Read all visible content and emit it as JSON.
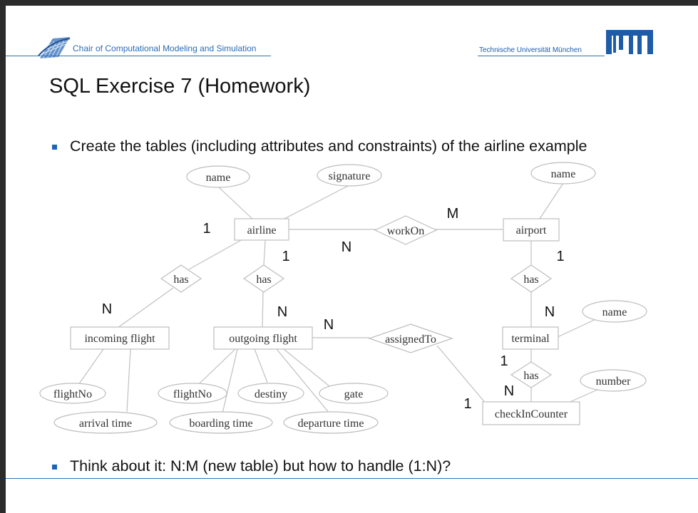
{
  "header": {
    "chair_name": "Chair of Computational Modeling and Simulation",
    "university": "Technische Universität München"
  },
  "slide": {
    "title": "SQL Exercise 7 (Homework)",
    "bullet_1": "Create the tables (including attributes and constraints) of the airline example",
    "bullet_2": "Think about it: N:M (new table) but how to handle (1:N)?"
  },
  "colors": {
    "accent_blue": "#2e74b5",
    "tum_blue": "#1f5ca8",
    "diagram_line": "#c0c0c0",
    "diagram_text": "#333333"
  },
  "diagram": {
    "entities": {
      "airline": "airline",
      "airport": "airport",
      "incoming_flight": "incoming flight",
      "outgoing_flight": "outgoing flight",
      "terminal": "terminal",
      "checkin_counter": "checkInCounter"
    },
    "relationships": {
      "has_incoming": "has",
      "has_outgoing": "has",
      "work_on": "workOn",
      "has_terminal": "has",
      "assigned_to": "assignedTo",
      "has_counter": "has"
    },
    "attributes": {
      "airline_name": "name",
      "airline_signature": "signature",
      "airport_name": "name",
      "terminal_name": "name",
      "counter_number": "number",
      "incoming_flightno": "flightNo",
      "incoming_arrival": "arrival time",
      "outgoing_flightno": "flightNo",
      "outgoing_destiny": "destiny",
      "outgoing_gate": "gate",
      "outgoing_boarding": "boarding time",
      "outgoing_departure": "departure time"
    },
    "cardinalities": {
      "airline_incoming": "1",
      "incoming": "N",
      "airline_outgoing": "1",
      "outgoing": "N",
      "airline_workon": "N",
      "airport_workon": "M",
      "airport_terminal": "1",
      "terminal_airport": "N",
      "outgoing_assigned": "N",
      "counter_assigned": "1",
      "terminal_counter": "1",
      "counter_terminal": "N"
    }
  }
}
